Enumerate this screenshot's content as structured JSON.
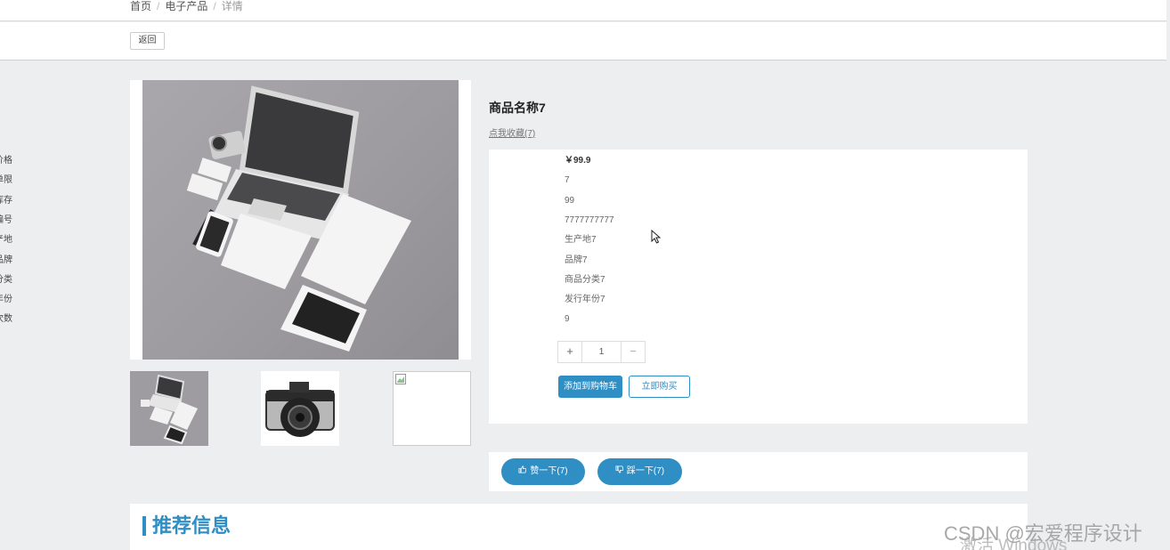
{
  "breadcrumb": {
    "home": "首页",
    "category": "电子产品",
    "current": "详情"
  },
  "toolbar": {
    "back_label": "返回"
  },
  "product": {
    "title": "商品名称7",
    "favorite_label": "点我收藏(7)",
    "fields": [
      {
        "key": "价格",
        "value": "￥99.9"
      },
      {
        "key": "单限",
        "value": "7"
      },
      {
        "key": "库存",
        "value": "99"
      },
      {
        "key": "商品编号",
        "value": "7777777777"
      },
      {
        "key": "生产地",
        "value": "生产地7"
      },
      {
        "key": "品牌",
        "value": "品牌7"
      },
      {
        "key": "商品分类",
        "value": "商品分类7"
      },
      {
        "key": "发行年份",
        "value": "发行年份7"
      },
      {
        "key": "点击次数",
        "value": "9"
      }
    ],
    "quantity": {
      "plus": "+",
      "value": "1",
      "minus": "−"
    },
    "add_to_cart_label": "添加到购物车",
    "buy_now_label": "立即购买"
  },
  "votes": {
    "up_label": "赞一下(7)",
    "down_label": "踩一下(7)",
    "up_icon": "thumbs-up-icon",
    "down_icon": "thumbs-down-icon"
  },
  "recommend": {
    "title": "推荐信息"
  },
  "overlay": {
    "watermark": "CSDN @宏爱程序设计",
    "activate": "激活 Windows"
  },
  "colors": {
    "accent": "#2f8ec4",
    "background": "#edeef0"
  }
}
